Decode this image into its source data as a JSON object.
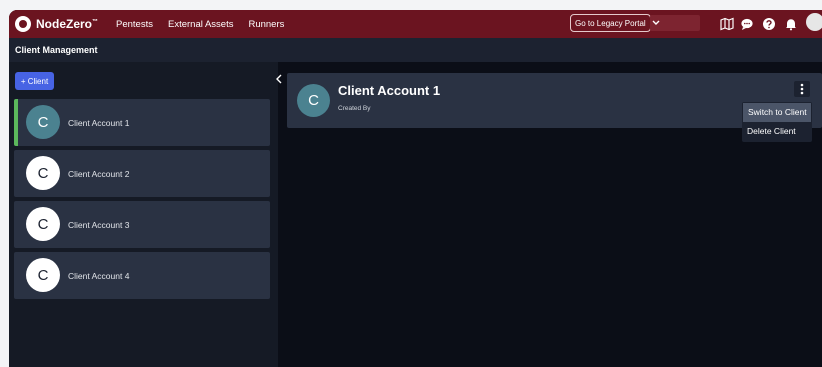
{
  "brand": {
    "name": "NodeZero",
    "mark": "™"
  },
  "nav": {
    "items": [
      "Pentests",
      "External Assets",
      "Runners"
    ]
  },
  "header": {
    "legacy_label": "Go to Legacy Portal"
  },
  "subheader": {
    "title": "Client Management"
  },
  "sidebar": {
    "add_label": "+ Client",
    "clients": [
      {
        "initial": "C",
        "name": "Client Account 1"
      },
      {
        "initial": "C",
        "name": "Client Account 2"
      },
      {
        "initial": "C",
        "name": "Client Account 3"
      },
      {
        "initial": "C",
        "name": "Client Account 4"
      }
    ]
  },
  "detail": {
    "initial": "C",
    "title": "Client Account 1",
    "subtitle": "Created By"
  },
  "menu": {
    "items": [
      "Switch to Client",
      "Delete Client"
    ]
  },
  "colors": {
    "topbar": "#6b1420",
    "accent": "#4763e4",
    "selected_bar": "#5cb85c",
    "avatar_selected": "#4b8290"
  }
}
